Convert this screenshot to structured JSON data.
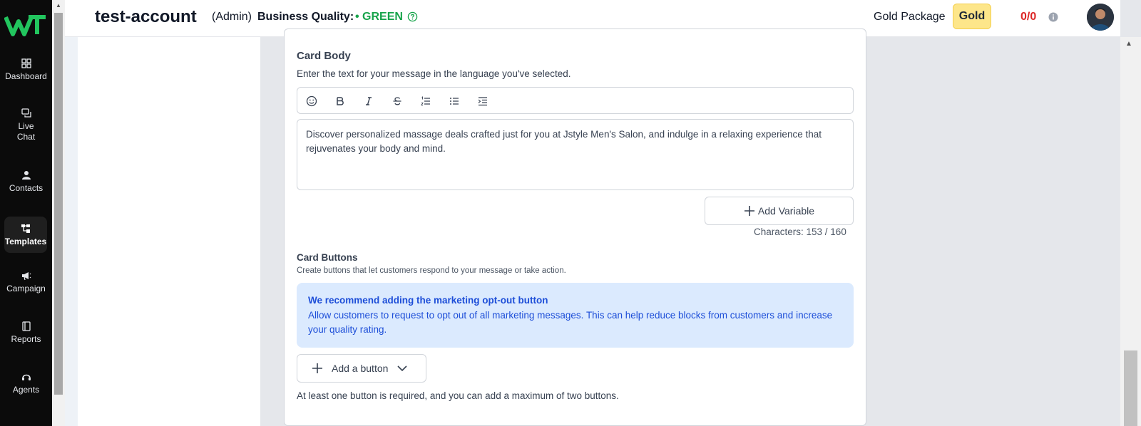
{
  "sidebar": {
    "logo_text": "WT",
    "items": [
      {
        "label": "Dashboard",
        "icon": "dashboard-icon"
      },
      {
        "label": "Live Chat",
        "icon": "chat-icon"
      },
      {
        "label": "Contacts",
        "icon": "user-icon"
      },
      {
        "label": "Templates",
        "icon": "templates-icon",
        "active": true
      },
      {
        "label": "Campaign",
        "icon": "megaphone-icon"
      },
      {
        "label": "Reports",
        "icon": "report-icon"
      },
      {
        "label": "Agents",
        "icon": "headset-icon"
      }
    ]
  },
  "header": {
    "account_name": "test-account",
    "role": "(Admin)",
    "business_quality_label": "Business Quality:",
    "business_quality_value": "• GREEN",
    "package_label": "Gold Package",
    "package_badge": "Gold",
    "credits": "0/0",
    "colors": {
      "quality": "#16a34a",
      "credits": "#dc2626",
      "badge": "#fde68a"
    }
  },
  "card_body": {
    "title": "Card Body",
    "description": "Enter the text for your message in the language you've selected.",
    "toolbar": [
      "emoji-icon",
      "bold-icon",
      "italic-icon",
      "strikethrough-icon",
      "ordered-list-icon",
      "bullet-list-icon",
      "indent-icon"
    ],
    "text": "Discover personalized massage deals crafted just for you at Jstyle Men's Salon, and indulge in a relaxing experience that rejuvenates your body and mind.",
    "add_variable_label": "Add Variable",
    "char_count": "Characters: 153 / 160"
  },
  "card_buttons": {
    "title": "Card Buttons",
    "description": "Create buttons that let customers respond to your message or take action.",
    "info_title": "We recommend adding the marketing opt-out button",
    "info_text": "Allow customers to request to opt out of all marketing messages. This can help reduce blocks from customers and increase your quality rating.",
    "add_button_label": "Add a button",
    "note": "At least one button is required, and you can add a maximum of two buttons."
  }
}
